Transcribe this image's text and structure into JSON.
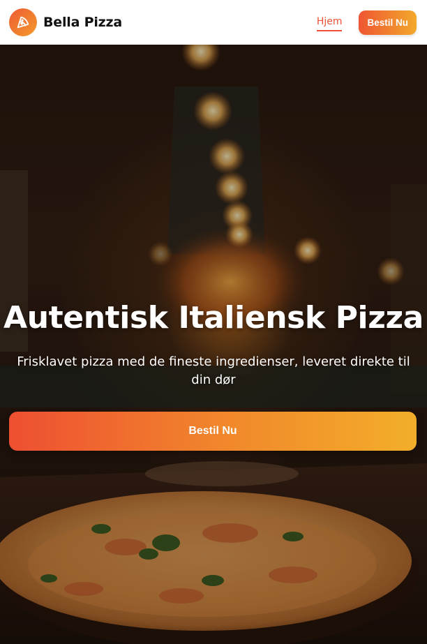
{
  "nav": {
    "brand_name": "Bella Pizza",
    "logo_icon": "pizza-slice-icon",
    "home_link": "Hjem",
    "order_button": "Bestil Nu"
  },
  "hero": {
    "title": "Autentisk Italiensk Pizza",
    "subtitle": "Frisklavet pizza med de fineste ingredienser, leveret direkte til din dør",
    "cta_label": "Bestil Nu",
    "background_image": "restaurant-interior-with-pizza"
  },
  "colors": {
    "accent_start": "#ee5133",
    "accent_end": "#f2ae2a",
    "nav_background": "#ffffff"
  }
}
